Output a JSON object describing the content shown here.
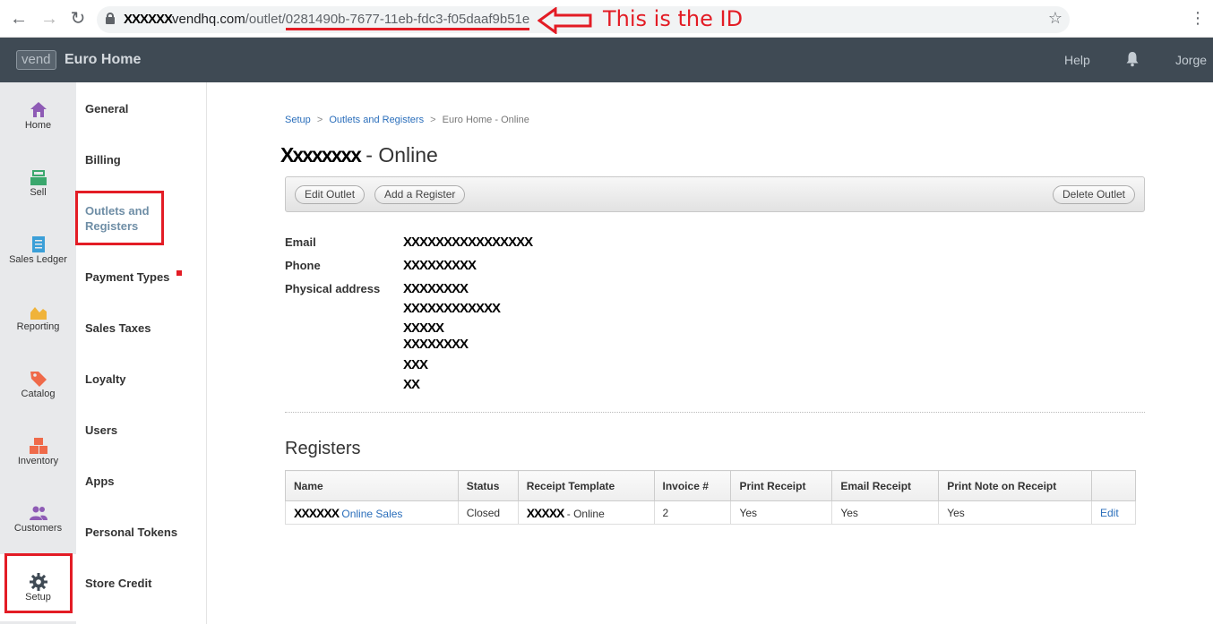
{
  "browser": {
    "url_redacted": "XXXXXX",
    "url_host": "vendhq.com",
    "url_path": "/outlet/",
    "url_id": "0281490b-7677-11eb-fdc3-f05daaf9b51e"
  },
  "annotation": {
    "text": "This is the ID",
    "color": "#e31c25"
  },
  "header": {
    "logo": "vend",
    "store_name": "Euro Home",
    "help": "Help",
    "user": "Jorge"
  },
  "rail": {
    "items": [
      {
        "label": "Home",
        "icon": "home-icon",
        "color": "#8e5bb5"
      },
      {
        "label": "Sell",
        "icon": "register-icon",
        "color": "#3aa76d"
      },
      {
        "label": "Sales Ledger",
        "icon": "ledger-icon",
        "color": "#3b9fd8"
      },
      {
        "label": "Reporting",
        "icon": "chart-icon",
        "color": "#f0b33a"
      },
      {
        "label": "Catalog",
        "icon": "tag-icon",
        "color": "#ef6a4a"
      },
      {
        "label": "Inventory",
        "icon": "boxes-icon",
        "color": "#ef6a4a"
      },
      {
        "label": "Customers",
        "icon": "people-icon",
        "color": "#8e5bb5"
      },
      {
        "label": "Setup",
        "icon": "gear-icon",
        "color": "#3f4a54"
      }
    ]
  },
  "submenu": {
    "items": [
      {
        "label": "General"
      },
      {
        "label": "Billing"
      },
      {
        "label": "Outlets and Registers",
        "active": true
      },
      {
        "label": "Payment Types"
      },
      {
        "label": "Sales Taxes"
      },
      {
        "label": "Loyalty"
      },
      {
        "label": "Users"
      },
      {
        "label": "Apps"
      },
      {
        "label": "Personal Tokens"
      },
      {
        "label": "Store Credit"
      }
    ]
  },
  "breadcrumb": {
    "setup": "Setup",
    "outlets": "Outlets and Registers",
    "current": "Euro Home - Online",
    "separator": ">"
  },
  "page": {
    "title_redacted": "Xxxxxxxx",
    "title_suffix": "- Online"
  },
  "toolbar": {
    "edit_outlet": "Edit Outlet",
    "add_register": "Add a Register",
    "delete_outlet": "Delete Outlet"
  },
  "details": {
    "email_label": "Email",
    "email_value": "XXXXXXXXXXXXXXXX",
    "phone_label": "Phone",
    "phone_value": "XXXXXXXXX",
    "address_label": "Physical address",
    "address_lines": [
      "XXXXXXXX",
      "XXXXXXXXXXXX",
      "XXXXX",
      "XXXXXXXX",
      "XXX",
      "XX"
    ]
  },
  "registers": {
    "title": "Registers",
    "columns": [
      "Name",
      "Status",
      "Receipt Template",
      "Invoice #",
      "Print Receipt",
      "Email Receipt",
      "Print Note on Receipt",
      ""
    ],
    "rows": [
      {
        "name_redacted": "XXXXXX",
        "name": "Online Sales",
        "status": "Closed",
        "template_redacted": "XXXXX",
        "template": "- Online",
        "invoice": "2",
        "print_receipt": "Yes",
        "email_receipt": "Yes",
        "print_note": "Yes",
        "action": "Edit"
      }
    ]
  }
}
